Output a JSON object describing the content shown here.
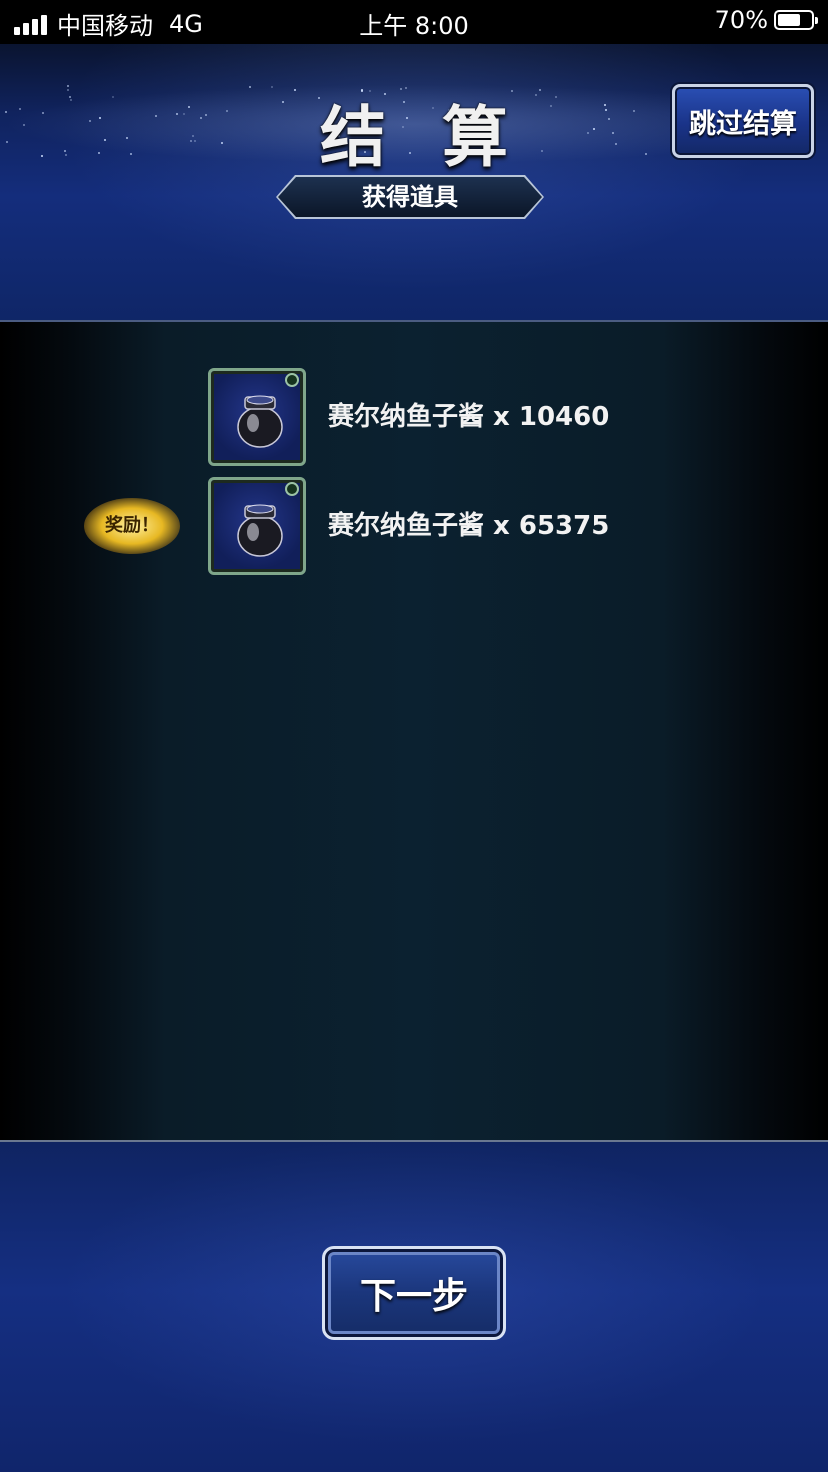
{
  "status_bar": {
    "carrier": "中国移动",
    "network": "4G",
    "time": "上午 8:00",
    "battery": "70%",
    "battery_level": 0.7
  },
  "header": {
    "title": "结算",
    "subtitle": "获得道具",
    "skip_label": "跳过结算"
  },
  "items": [
    {
      "name": "赛尔纳鱼子酱 x 10460",
      "icon": "caviar-jar-icon",
      "bonus": false
    },
    {
      "name": "赛尔纳鱼子酱 x 65375",
      "icon": "caviar-jar-icon",
      "bonus": true
    }
  ],
  "bonus_label": "奖励！",
  "footer": {
    "next_label": "下一步"
  },
  "colors": {
    "header_blue": "#142d7c",
    "panel_teal": "#0b2130",
    "icon_border_green": "#7fa68a",
    "bonus_gold": "#e7b823"
  }
}
